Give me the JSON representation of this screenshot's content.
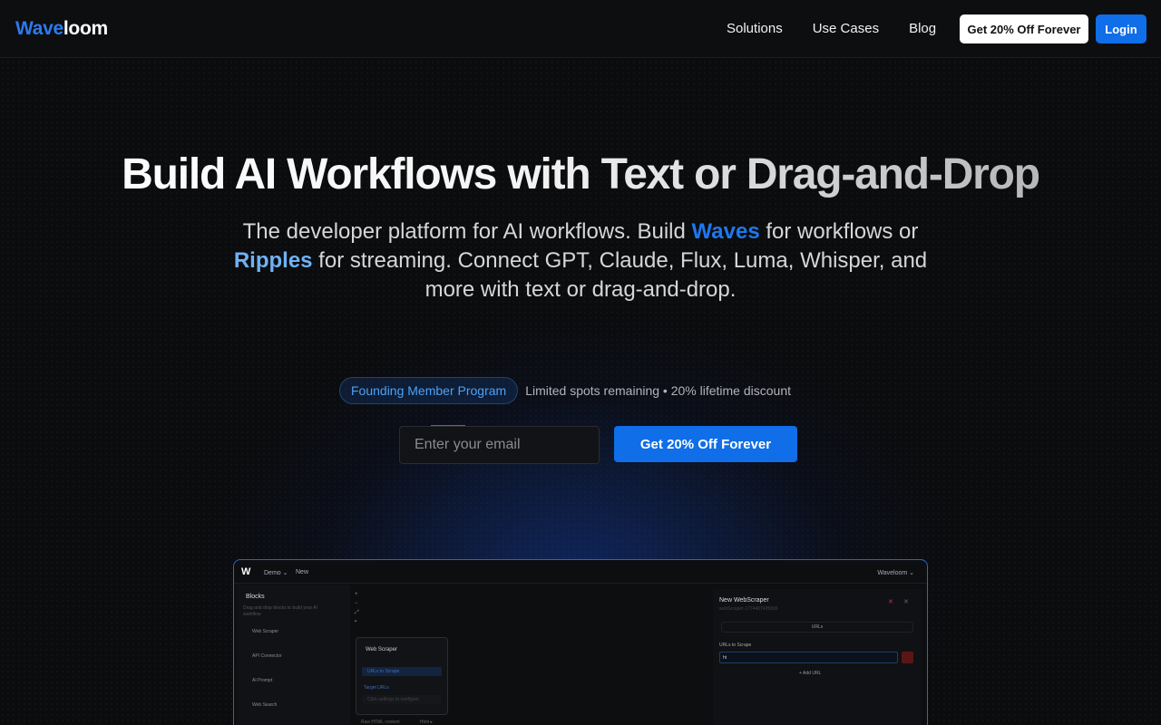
{
  "brand": {
    "part1": "Wave",
    "part2": "loom"
  },
  "nav": {
    "links": [
      "Solutions",
      "Use Cases",
      "Blog"
    ],
    "promo_label": "Get 20% Off Forever",
    "login_label": "Login"
  },
  "hero": {
    "title": "Build AI Workflows with Text or Drag-and-Drop",
    "sub_part1": "The developer platform for AI workflows. Build ",
    "sub_waves": "Waves",
    "sub_part2": " for workflows or ",
    "sub_ripples": "Ripples",
    "sub_part3": " for streaming. Connect GPT, Claude, Flux, Luma, Whisper, and more with text or drag-and-drop."
  },
  "founding": {
    "badge": "Founding Member Program",
    "note": "Limited spots remaining • 20% lifetime discount"
  },
  "signup": {
    "email_placeholder": "Enter your email",
    "cta_label": "Get 20% Off Forever"
  },
  "preview": {
    "workspace_menu": "Demo",
    "new_label": "New",
    "account": "Waveloom",
    "sidebar_title": "Blocks",
    "sidebar_desc": "Drag and drop blocks to build your AI workflow",
    "blocks": [
      "Web Scraper",
      "API Connector",
      "AI Prompt",
      "Web Search"
    ],
    "node_title": "Web Scraper",
    "node_row1": "URLs to Scrape",
    "node_row2": "Target URLs",
    "node_row3": "Click settings to configure",
    "node_footer": "Raw HTML content",
    "node_footer_tag": "Html",
    "panel_title": "New WebScraper",
    "panel_id": "webScraper-1774407435806",
    "panel_tab": "URLs",
    "panel_label": "URLs to Scrape",
    "panel_input": "ht",
    "panel_add": "Add URL"
  },
  "colors": {
    "accent": "#0f6ee8",
    "waves": "#1c78f0",
    "ripples": "#6fb2f5",
    "background": "#0b0c0e"
  }
}
